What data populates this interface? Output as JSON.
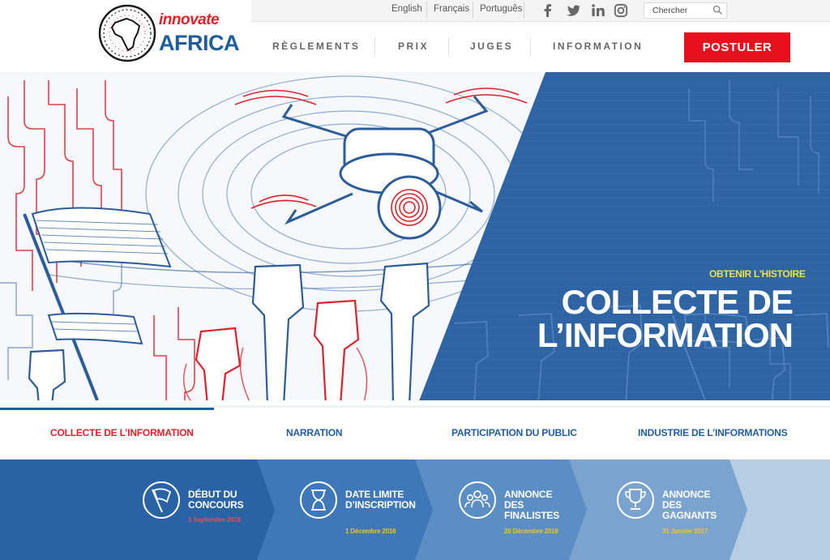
{
  "brand": {
    "line1": "innovate",
    "line2": "AFRICA"
  },
  "topbar": {
    "languages": [
      "English",
      "Français",
      "Português"
    ],
    "social": [
      "facebook-icon",
      "twitter-icon",
      "linkedin-icon",
      "instagram-icon"
    ],
    "search_placeholder": "Chercher"
  },
  "nav": {
    "items": [
      "RÈGLEMENTS",
      "PRIX",
      "JUGES",
      "INFORMATION"
    ],
    "apply_label": "POSTULER"
  },
  "hero": {
    "kicker": "OBTENIR L'HISTOIRE",
    "title_line1": "COLLECTE DE",
    "title_line2": "L’INFORMATION"
  },
  "tabs": {
    "items": [
      "COLLECTE DE L’INFORMATION",
      "NARRATION",
      "PARTICIPATION DU PUBLIC",
      "INDUSTRIE DE L’INFORMATIONS"
    ],
    "active_index": 0
  },
  "timeline": [
    {
      "icon": "flag-icon",
      "title": "DÉBUT DU CONCOURS",
      "date": "1 Septembre 2016",
      "date_color": "#f04b55"
    },
    {
      "icon": "hourglass-icon",
      "title": "DATE LIMITE D’INSCRIPTION",
      "date": "1 Décembre 2016",
      "date_color": "#f3c51e"
    },
    {
      "icon": "people-icon",
      "title": "ANNONCE DES FINALISTES",
      "date": "20 Décembre 2016",
      "date_color": "#f3c51e"
    },
    {
      "icon": "trophy-icon",
      "title": "ANNONCE DES GAGNANTS",
      "date": "31 Janvier 2017",
      "date_color": "#f3c51e"
    }
  ],
  "colors": {
    "brand_blue": "#1f5e9e",
    "accent_red": "#e8101c",
    "kicker_yellow": "#f0e23a"
  }
}
